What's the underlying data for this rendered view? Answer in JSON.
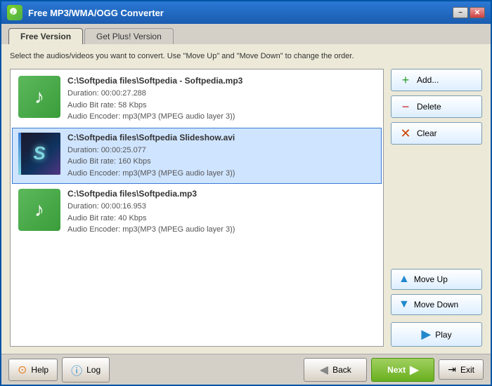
{
  "window": {
    "title": "Free MP3/WMA/OGG Converter",
    "title_btn_min": "−",
    "title_btn_close": "✕"
  },
  "tabs": [
    {
      "id": "free",
      "label": "Free Version",
      "active": true
    },
    {
      "id": "plus",
      "label": "Get Plus! Version",
      "active": false
    }
  ],
  "instruction": "Select the audios/videos you want to convert. Use \"Move Up\" and \"Move Down\" to change the order.",
  "files": [
    {
      "id": 1,
      "name": "C:\\Softpedia files\\Softpedia - Softpedia.mp3",
      "duration": "Duration: 00:00:27.288",
      "bitrate": "Audio Bit rate: 58 Kbps",
      "encoder": "Audio Encoder: mp3(MP3 (MPEG audio layer 3))",
      "type": "music",
      "selected": false
    },
    {
      "id": 2,
      "name": "C:\\Softpedia files\\Softpedia Slideshow.avi",
      "duration": "Duration: 00:00:25.077",
      "bitrate": "Audio Bit rate: 160 Kbps",
      "encoder": "Audio Encoder: mp3(MP3 (MPEG audio layer 3))",
      "type": "video",
      "selected": true
    },
    {
      "id": 3,
      "name": "C:\\Softpedia files\\Softpedia.mp3",
      "duration": "Duration: 00:00:16.953",
      "bitrate": "Audio Bit rate: 40 Kbps",
      "encoder": "Audio Encoder: mp3(MP3 (MPEG audio layer 3))",
      "type": "music",
      "selected": false
    }
  ],
  "buttons": {
    "add": "Add...",
    "delete": "Delete",
    "clear": "Clear",
    "move_up": "Move Up",
    "move_down": "Move Down",
    "play": "Play",
    "help": "Help",
    "log": "Log",
    "back": "Back",
    "next": "Next",
    "exit": "Exit"
  }
}
